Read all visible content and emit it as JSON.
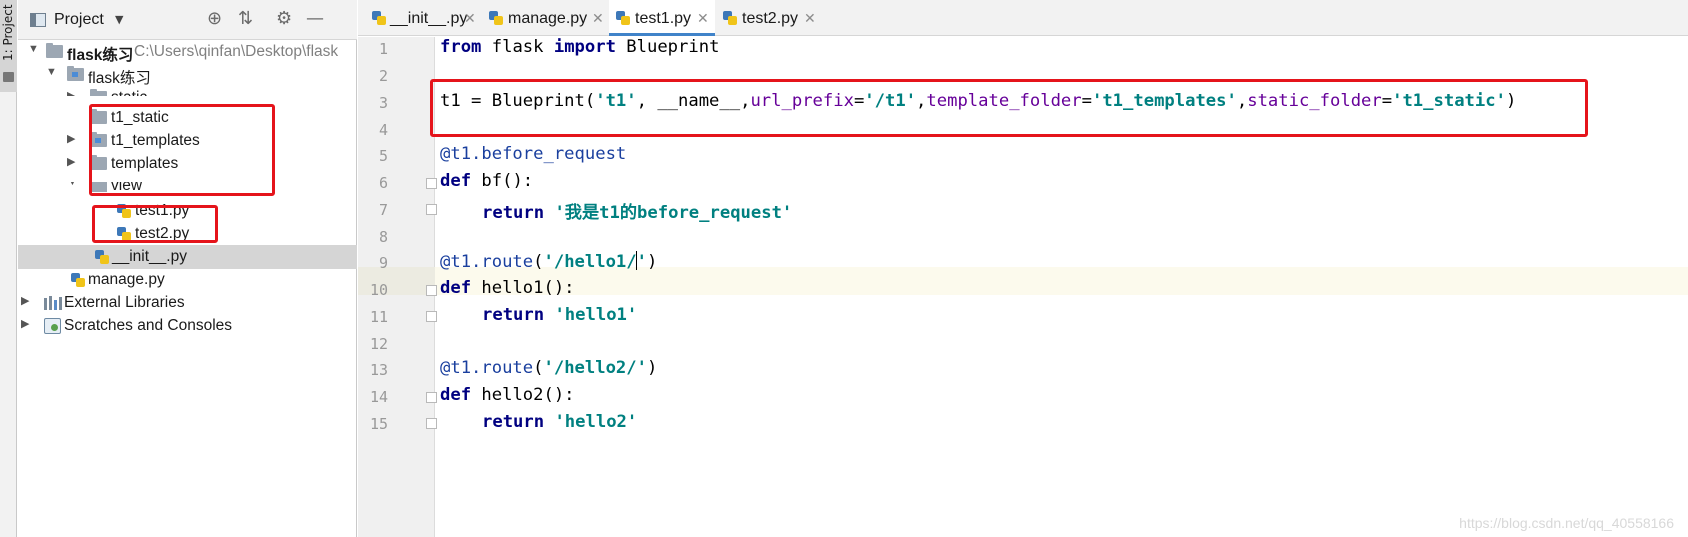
{
  "tool_window": {
    "vertical_tab_label": "1: Project"
  },
  "project_panel": {
    "title": "Project",
    "icons": [
      "locate-icon",
      "collapse-all-icon",
      "settings-gear-icon",
      "hide-minus-icon"
    ],
    "tree": [
      {
        "label": "flask练习",
        "path": "C:\\Users\\qinfan\\Desktop\\flask",
        "type": "folder",
        "bold": true
      },
      {
        "label": "flask练习",
        "type": "module-folder"
      },
      {
        "label": "static",
        "type": "folder"
      },
      {
        "label": "t1_static",
        "type": "folder"
      },
      {
        "label": "t1_templates",
        "type": "module-folder"
      },
      {
        "label": "templates",
        "type": "folder"
      },
      {
        "label": "view",
        "type": "folder"
      },
      {
        "label": "test1.py",
        "type": "python-file"
      },
      {
        "label": "test2.py",
        "type": "python-file"
      },
      {
        "label": "__init__.py",
        "type": "python-file",
        "selected": true
      },
      {
        "label": "manage.py",
        "type": "python-file"
      },
      {
        "label": "External Libraries",
        "type": "libraries"
      },
      {
        "label": "Scratches and Consoles",
        "type": "scratches"
      }
    ]
  },
  "editor_tabs": [
    {
      "label": "__init__.py",
      "active": false
    },
    {
      "label": "manage.py",
      "active": false
    },
    {
      "label": "test1.py",
      "active": true
    },
    {
      "label": "test2.py",
      "active": false
    }
  ],
  "editor": {
    "line_numbers": [
      "1",
      "2",
      "3",
      "4",
      "5",
      "6",
      "7",
      "8",
      "9",
      "10",
      "11",
      "12",
      "13",
      "14",
      "15"
    ],
    "current_line": "9",
    "tokens": {
      "l1_from": "from",
      "l1_mod": " flask ",
      "l1_import": "import",
      "l1_name": " Blueprint",
      "l3_a": "t1 = Blueprint(",
      "l3_s1": "'t1'",
      "l3_b": ", __name__,",
      "l3_p1": "url_prefix",
      "l3_eq1": "=",
      "l3_s2": "'/t1'",
      "l3_c1": ",",
      "l3_p2": "template_folder",
      "l3_eq2": "=",
      "l3_s3": "'t1_templates'",
      "l3_c2": ",",
      "l3_p3": "static_folder",
      "l3_eq3": "=",
      "l3_s4": "'t1_static'",
      "l3_end": ")",
      "l5_deco": "@t1.before_request",
      "l6_def": "def",
      "l6_rest": " bf():",
      "l7_ret": "return",
      "l7_str": "'我是t1的before_request'",
      "l9_deco": "@t1.route",
      "l9_open": "(",
      "l9_s_a": "'/hello1/",
      "l9_s_b": "'",
      "l9_close": ")",
      "l10_def": "def",
      "l10_rest": " hello1():",
      "l11_ret": "return",
      "l11_str": "'hello1'",
      "l13_deco": "@t1.route",
      "l13_open": "(",
      "l13_str": "'/hello2/'",
      "l13_close": ")",
      "l14_def": "def",
      "l14_rest": " hello2():",
      "l15_ret": "return",
      "l15_str": "'hello2'"
    }
  },
  "annotations": {
    "highlight_color": "#e5141b"
  },
  "watermark": "https://blog.csdn.net/qq_40558166",
  "colors": {
    "keyword": "#000080",
    "string": "#008080",
    "decorator": "#1a3f9e",
    "named_param": "#660099",
    "active_tab_underline": "#4083c9",
    "caret_line": "#fcfaed"
  }
}
